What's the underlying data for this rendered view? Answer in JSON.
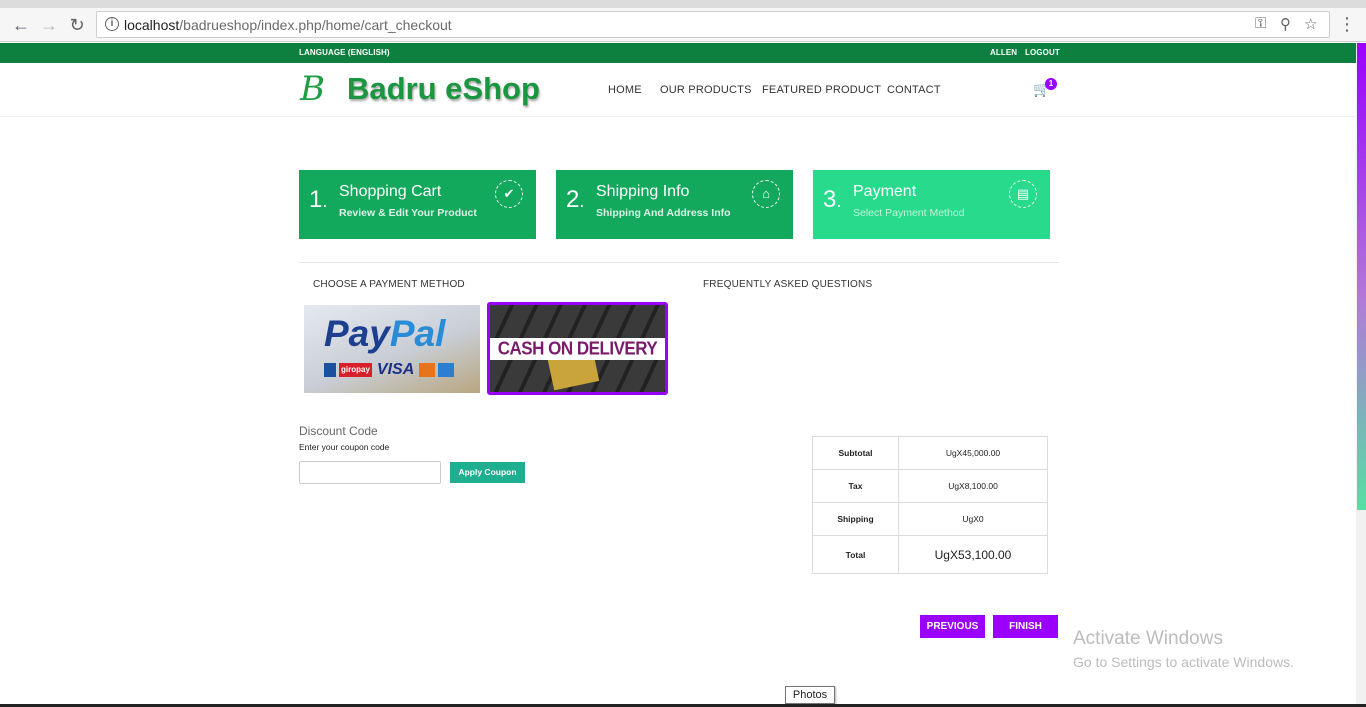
{
  "browser": {
    "url_host": "localhost",
    "url_path": "/badrueshop/index.php/home/cart_checkout",
    "icons": [
      "back-icon",
      "forward-icon",
      "reload-icon",
      "info-icon",
      "key-icon",
      "zoom-icon",
      "star-icon",
      "menu-icon"
    ]
  },
  "topbar": {
    "language": "LANGUAGE (ENGLISH)",
    "user": "ALLEN",
    "logout": "LOGOUT"
  },
  "header": {
    "logo_mark": "B",
    "logo_text": "Badru eShop",
    "nav": [
      "HOME",
      "OUR PRODUCTS",
      "FEATURED PRODUCT",
      "CONTACT"
    ],
    "cart_count": "1"
  },
  "steps": [
    {
      "num": "1",
      "title": "Shopping Cart",
      "sub": "Review & Edit Your Product",
      "icon": "check-icon"
    },
    {
      "num": "2",
      "title": "Shipping Info",
      "sub": "Shipping And Address Info",
      "icon": "home-icon"
    },
    {
      "num": "3",
      "title": "Payment",
      "sub": "Select Payment Method",
      "icon": "credit-card-icon"
    }
  ],
  "payment": {
    "heading": "CHOOSE A PAYMENT METHOD",
    "faq_heading": "FREQUENTLY ASKED QUESTIONS",
    "paypal_logo": "PayPal",
    "paypal_logo_a": "Pay",
    "paypal_logo_b": "Pal",
    "paypal_cards": [
      "giropay",
      "VISA"
    ],
    "cod_label": "CASH ON DELIVERY",
    "selected": "cash-on-delivery"
  },
  "discount": {
    "title": "Discount Code",
    "subtitle": "Enter your coupon code",
    "input_value": "",
    "apply_label": "Apply Coupon"
  },
  "totals": [
    {
      "label": "Subtotal",
      "value": "UgX45,000.00"
    },
    {
      "label": "Tax",
      "value": "UgX8,100.00"
    },
    {
      "label": "Shipping",
      "value": "UgX0"
    },
    {
      "label": "Total",
      "value": "UgX53,100.00"
    }
  ],
  "actions": {
    "previous": "PREVIOUS",
    "finish": "FINISH"
  },
  "overlay": {
    "activate_title": "Activate Windows",
    "activate_sub": "Go to Settings to activate Windows.",
    "tooltip": "Photos"
  },
  "colors": {
    "brand_green": "#0d7f3f",
    "step_green": "#12a95d",
    "step_active": "#28db8c",
    "accent_purple": "#9b00ff",
    "coupon_teal": "#1fae8f"
  }
}
